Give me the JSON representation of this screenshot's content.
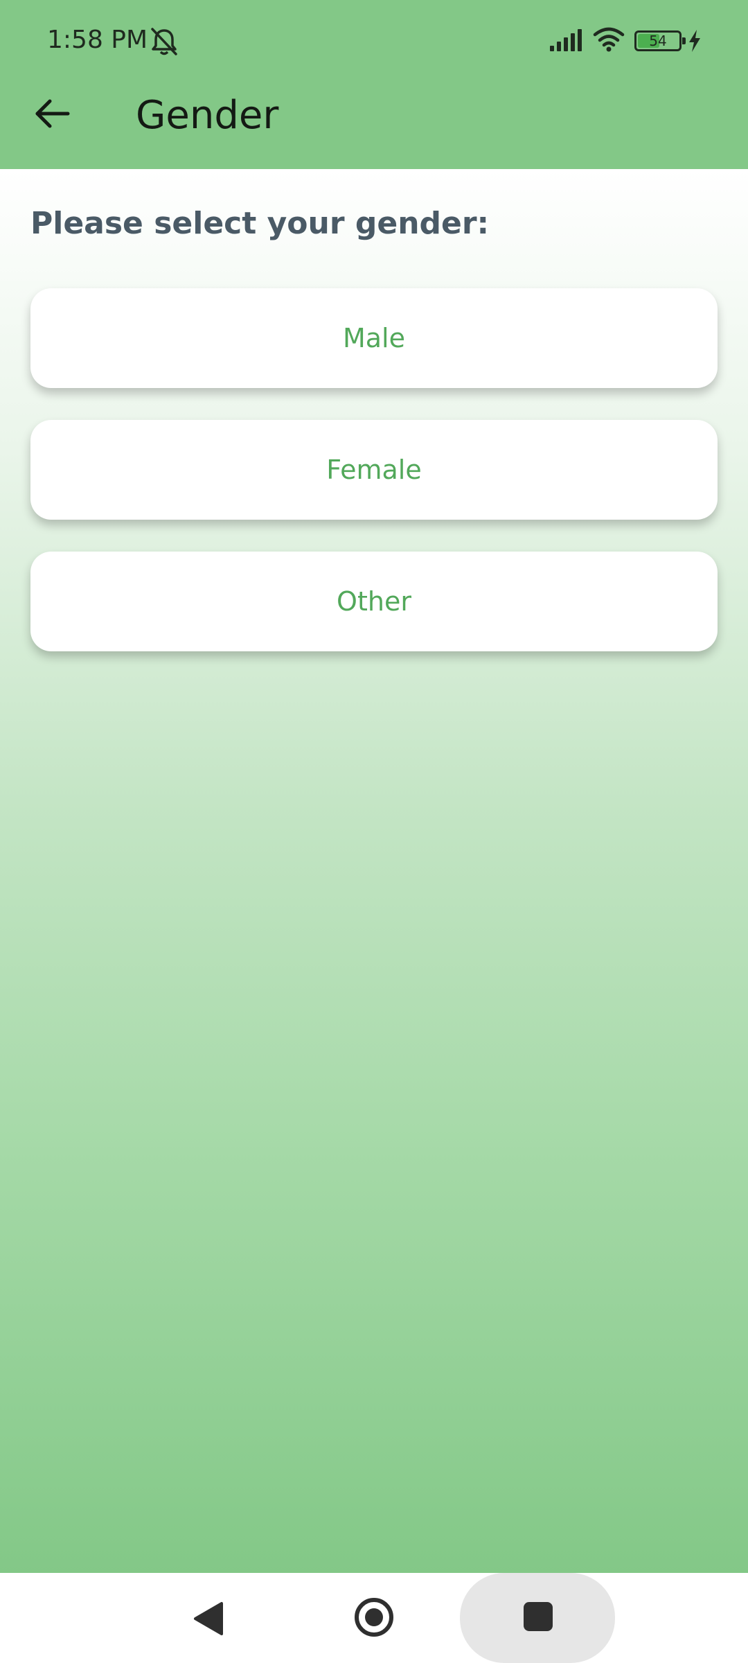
{
  "status_bar": {
    "time": "1:58 PM",
    "battery_level": "54",
    "battery_fraction": 0.54,
    "icons": [
      "bell-muted-icon",
      "signal-icon",
      "wifi-icon",
      "battery-icon",
      "charging-bolt-icon"
    ]
  },
  "app_bar": {
    "back_icon": "arrow-left-icon",
    "title": "Gender"
  },
  "main": {
    "prompt": "Please select your gender:",
    "options": [
      {
        "label": "Male"
      },
      {
        "label": "Female"
      },
      {
        "label": "Other"
      }
    ]
  },
  "nav_bar": {
    "icons": [
      "nav-back-icon",
      "nav-home-icon",
      "nav-recents-icon"
    ]
  },
  "colors": {
    "app_bar": "#83c887",
    "option_text": "#52a85a",
    "prompt_text": "#4a5a66",
    "gradient_top": "#ffffff",
    "gradient_bottom": "#83c887"
  }
}
